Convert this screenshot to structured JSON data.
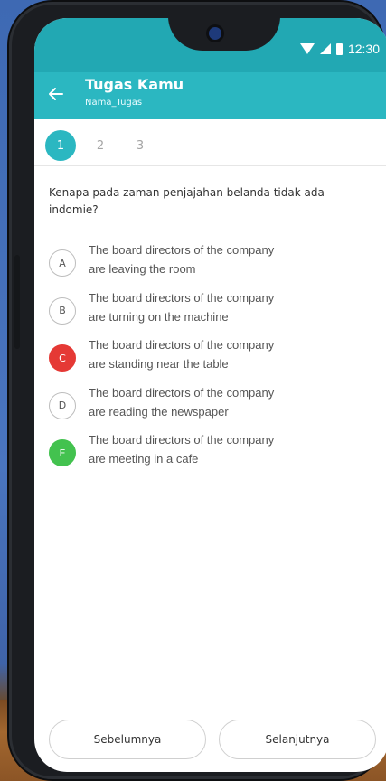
{
  "status_bar": {
    "time": "12:30"
  },
  "app_bar": {
    "title": "Tugas Kamu",
    "subtitle": "Nama_Tugas"
  },
  "stepper": {
    "steps": [
      "1",
      "2",
      "3"
    ],
    "active": "1"
  },
  "question": "Kenapa pada zaman penjajahan belanda tidak ada indomie?",
  "options": [
    {
      "letter": "A",
      "line1": "The board directors of the company",
      "line2": "are leaving the room",
      "state": "default"
    },
    {
      "letter": "B",
      "line1": "The board directors of the company",
      "line2": "are turning on the machine",
      "state": "default"
    },
    {
      "letter": "C",
      "line1": "The board directors of the company",
      "line2": "are standing near the table",
      "state": "wrong"
    },
    {
      "letter": "D",
      "line1": "The board directors of the company",
      "line2": "are reading the newspaper",
      "state": "default"
    },
    {
      "letter": "E",
      "line1": "The board directors of the company",
      "line2": "are meeting in a cafe",
      "state": "correct"
    }
  ],
  "footer": {
    "prev_label": "Sebelumnya",
    "next_label": "Selanjutnya"
  },
  "colors": {
    "primary": "#2bb7c1",
    "wrong": "#e53935",
    "correct": "#43c24f"
  },
  "icons": {
    "back": "arrow-left-icon",
    "wifi": "wifi-icon",
    "signal": "signal-icon",
    "battery": "battery-icon"
  }
}
